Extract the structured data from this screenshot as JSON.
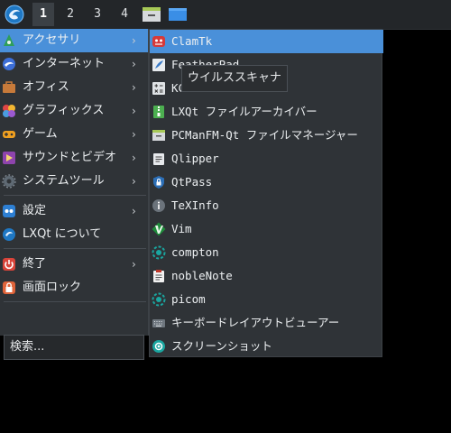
{
  "panel": {
    "workspaces": [
      "1",
      "2",
      "3",
      "4"
    ],
    "active_workspace": "1",
    "logo_icon": "lxqt-logo-icon",
    "tasks": [
      "file-manager-icon",
      "desktop-icon"
    ]
  },
  "menu": {
    "items": [
      {
        "label": "アクセサリ",
        "icon": "accessories-icon",
        "submenu": true,
        "highlighted": true
      },
      {
        "label": "インターネット",
        "icon": "internet-icon",
        "submenu": true
      },
      {
        "label": "オフィス",
        "icon": "office-icon",
        "submenu": true
      },
      {
        "label": "グラフィックス",
        "icon": "graphics-icon",
        "submenu": true
      },
      {
        "label": "ゲーム",
        "icon": "games-icon",
        "submenu": true
      },
      {
        "label": "サウンドとビデオ",
        "icon": "multimedia-icon",
        "submenu": true
      },
      {
        "label": "システムツール",
        "icon": "system-tools-icon",
        "submenu": true
      },
      {
        "label": "設定",
        "icon": "settings-icon",
        "submenu": true
      },
      {
        "label": "LXQt について",
        "icon": "lxqt-about-icon",
        "submenu": false
      },
      {
        "label": "終了",
        "icon": "power-icon",
        "submenu": true
      },
      {
        "label": "画面ロック",
        "icon": "lock-icon",
        "submenu": false
      }
    ],
    "search_placeholder": "検索..."
  },
  "submenu": {
    "items": [
      {
        "label": "ClamTk",
        "icon": "clamtk-icon",
        "highlighted": true
      },
      {
        "label": "FeatherPad",
        "icon": "featherpad-icon"
      },
      {
        "label": "KCalc",
        "icon": "calculator-icon"
      },
      {
        "label": "LXQt ファイルアーカイバー",
        "icon": "archiver-icon"
      },
      {
        "label": "PCManFM-Qt ファイルマネージャー",
        "icon": "file-manager-icon"
      },
      {
        "label": "Qlipper",
        "icon": "clipboard-icon"
      },
      {
        "label": "QtPass",
        "icon": "password-icon"
      },
      {
        "label": "TeXInfo",
        "icon": "info-icon"
      },
      {
        "label": "Vim",
        "icon": "vim-icon"
      },
      {
        "label": "compton",
        "icon": "compton-icon"
      },
      {
        "label": "nobleNote",
        "icon": "notes-icon"
      },
      {
        "label": "picom",
        "icon": "picom-icon"
      },
      {
        "label": "キーボードレイアウトビューアー",
        "icon": "keyboard-icon"
      },
      {
        "label": "スクリーンショット",
        "icon": "screenshot-icon"
      }
    ]
  },
  "tooltip": "ウイルススキャナ",
  "colors": {
    "highlight": "#4a90d9",
    "menu_bg": "#2f3337",
    "panel_bg": "#232629"
  }
}
